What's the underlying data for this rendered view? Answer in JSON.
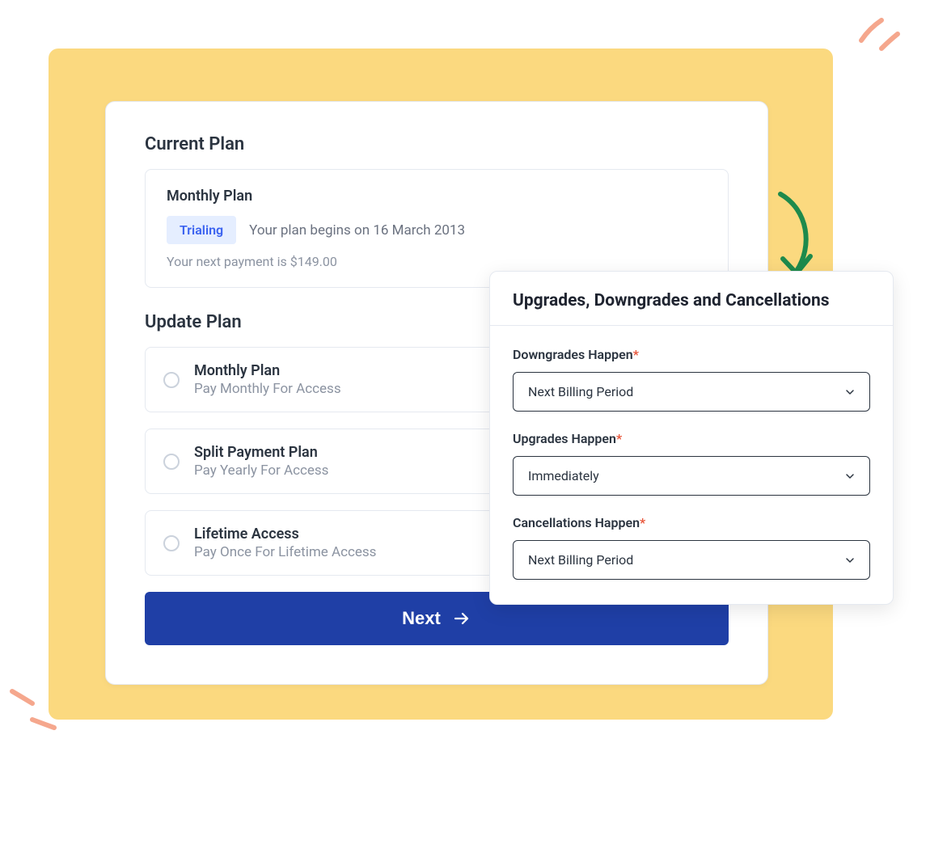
{
  "colors": {
    "accent": "#1F3FA6",
    "badge_bg": "#E5EEFF",
    "badge_fg": "#3B63F0",
    "required": "#E8553A"
  },
  "current_plan": {
    "section_title": "Current Plan",
    "plan_name": "Monthly Plan",
    "status_badge": "Trialing",
    "begin_text": "Your plan begins on 16 March 2013",
    "payment_text": "Your next payment is $149.00"
  },
  "update_plan": {
    "section_title": "Update Plan",
    "options": [
      {
        "title": "Monthly Plan",
        "subtitle": "Pay Monthly For Access"
      },
      {
        "title": "Split Payment Plan",
        "subtitle": "Pay Yearly For Access"
      },
      {
        "title": "Lifetime Access",
        "subtitle": "Pay Once For Lifetime Access"
      }
    ]
  },
  "next_button": "Next",
  "settings": {
    "title": "Upgrades, Downgrades and Cancellations",
    "required_mark": "*",
    "fields": [
      {
        "label": "Downgrades Happen",
        "value": "Next Billing Period"
      },
      {
        "label": "Upgrades Happen",
        "value": "Immediately"
      },
      {
        "label": "Cancellations Happen",
        "value": "Next Billing Period"
      }
    ]
  }
}
